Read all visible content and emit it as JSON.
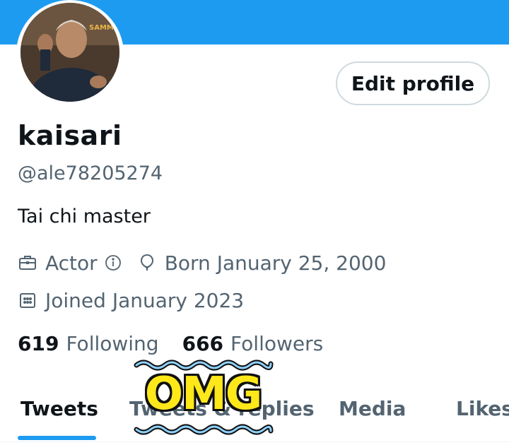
{
  "profile": {
    "display_name": "kaisari",
    "handle": "@ale78205274",
    "bio": "Tai chi master",
    "profession": "Actor",
    "birthday": "Born January 25, 2000",
    "joined": "Joined January 2023",
    "edit_button_label": "Edit profile",
    "avatar_caption": "SAMMO HUNG"
  },
  "stats": {
    "following_count": "619",
    "following_label": "Following",
    "followers_count": "666",
    "followers_label": "Followers"
  },
  "tabs": [
    {
      "label": "Tweets",
      "active": true
    },
    {
      "label": "Tweets & replies",
      "active": false
    },
    {
      "label": "Media",
      "active": false
    },
    {
      "label": "Likes",
      "active": false
    }
  ],
  "sticker": {
    "text": "OMG"
  },
  "icons": {
    "profession": "briefcase-icon",
    "info": "info-icon",
    "birthday": "balloon-icon",
    "joined": "calendar-icon"
  },
  "colors": {
    "accent": "#1d9bf0",
    "text_primary": "#0f1419",
    "text_secondary": "#536471",
    "sticker_yellow": "#ffe81a"
  }
}
